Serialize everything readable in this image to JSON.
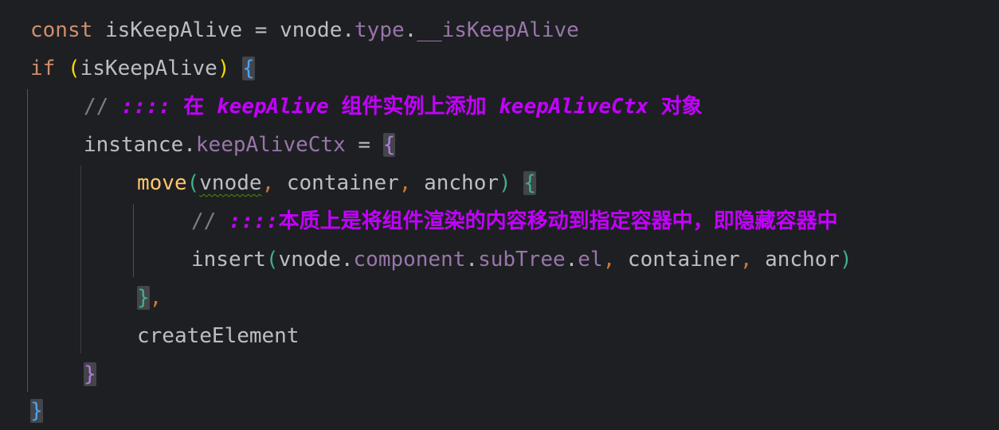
{
  "code": {
    "line1": {
      "kw": "const",
      "name": "isKeepAlive",
      "eq": "=",
      "obj": "vnode",
      "dot1": ".",
      "prop1": "type",
      "dot2": ".",
      "prop2": "__isKeepAlive"
    },
    "line2": {
      "kw": "if",
      "open_paren": "(",
      "cond": "isKeepAlive",
      "close_paren": ")",
      "brace": "{"
    },
    "line3": {
      "slashes": "//",
      "marker": "::::",
      "text": [
        {
          "t": "在",
          "cn": true
        },
        {
          "t": "keepAlive",
          "cn": false
        },
        {
          "t": "组件实例上添加",
          "cn": true
        },
        {
          "t": "keepAliveCtx",
          "cn": false
        },
        {
          "t": "对象",
          "cn": true
        }
      ]
    },
    "line4": {
      "obj": "instance",
      "dot": ".",
      "prop": "keepAliveCtx",
      "eq": "=",
      "brace": "{"
    },
    "line5": {
      "fn": "move",
      "open": "(",
      "arg1": "vnode",
      "c1": ",",
      "arg2": "container",
      "c2": ",",
      "arg3": "anchor",
      "close": ")",
      "brace": "{"
    },
    "line6": {
      "slashes": "//",
      "marker": "::::",
      "text": "本质上是将组件渲染的内容移动到指定容器中，即隐藏容器中"
    },
    "line7": {
      "fn": "insert",
      "open": "(",
      "a": "vnode",
      "d1": ".",
      "b": "component",
      "d2": ".",
      "c": "subTree",
      "d3": ".",
      "d": "el",
      "c1": ",",
      "arg2": "container",
      "c2": ",",
      "arg3": "anchor",
      "close": ")"
    },
    "line8": {
      "brace": "}",
      "comma": ","
    },
    "line9": {
      "name": "createElement"
    },
    "line10": {
      "brace": "}"
    },
    "line11": {
      "brace": "}"
    }
  },
  "colors": {
    "background": "#1e1f22",
    "keyword": "#cf8e6d",
    "property": "#9876aa",
    "function": "#ffc66d",
    "comment": "#7a7e85",
    "todo": "#c300ff",
    "text": "#bcbec4"
  }
}
